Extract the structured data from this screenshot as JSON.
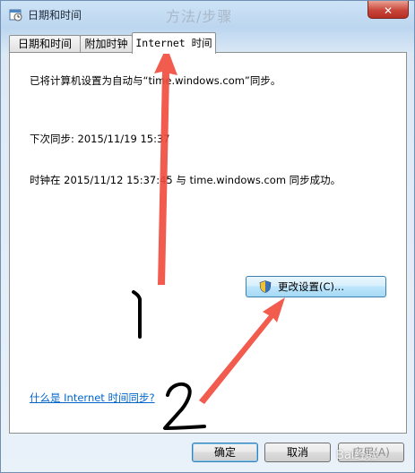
{
  "window": {
    "title": "日期和时间",
    "ghost_title": "方法/步骤"
  },
  "tabs": [
    {
      "label": "日期和时间"
    },
    {
      "label": "附加时钟"
    },
    {
      "label": "Internet 时间"
    }
  ],
  "internet_time": {
    "sync_status": "已将计算机设置为自动与“time.windows.com”同步。",
    "next_sync": "下次同步: 2015/11/19 15:37",
    "last_sync": "时钟在 2015/11/12 15:37:45 与 time.windows.com 同步成功。",
    "change_settings_label": "更改设置(C)...",
    "help_link": "什么是 Internet 时间同步?"
  },
  "footer": {
    "ok_label": "确定",
    "cancel_label": "取消",
    "apply_label": "应用(A)"
  },
  "annotations": {
    "step1": "1",
    "step2": "2",
    "arrow_color": "#f04a3c"
  },
  "watermark": "Bai经验"
}
